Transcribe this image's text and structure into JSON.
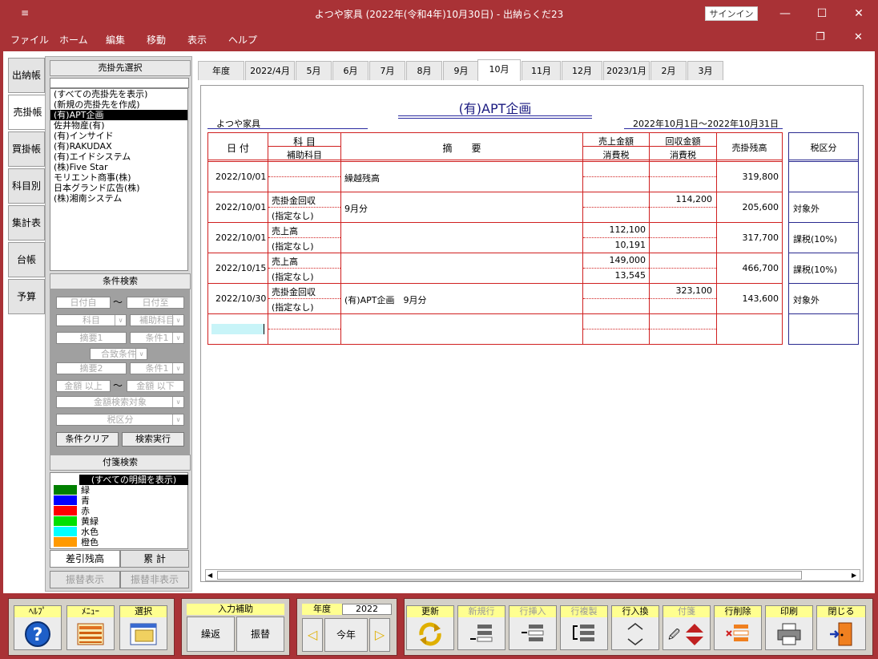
{
  "window": {
    "qa_icon": "≡",
    "title": "よつや家具 (2022年(令和4年)10月30日)  -  出納らくだ23",
    "signin": "サインイン",
    "min": "—",
    "max": "☐",
    "close": "✕",
    "restore": "❐"
  },
  "menu": [
    "ファイル",
    "ホーム",
    "編集",
    "移動",
    "表示",
    "ヘルプ"
  ],
  "side_tabs": [
    "出納帳",
    "売掛帳",
    "買掛帳",
    "科目別",
    "集計表",
    "台帳",
    "予算"
  ],
  "customer_panel": {
    "header": "売掛先選択",
    "items": [
      "(すべての売掛先を表示)",
      "(新規の売掛先を作成)",
      "(有)APT企画",
      "佐井物産(有)",
      "(有)インサイド",
      "(有)RAKUDAX",
      "(有)エイドシステム",
      "(株)Five Star",
      "モリエント商事(株)",
      "日本グランド広告(株)",
      "(株)湘南システム"
    ],
    "selected_index": 2
  },
  "search_panel": {
    "header": "条件検索",
    "date_from": "日付自",
    "tilde": "〜",
    "date_to": "日付至",
    "subject": "科目",
    "sub_subject": "補助科目",
    "memo1": "摘要1",
    "cond1": "条件1",
    "match": "合致条件",
    "memo2": "摘要2",
    "cond2": "条件1",
    "amount_from": "金額 以上",
    "amount_to": "金額 以下",
    "amount_target": "金額検索対象",
    "tax": "税区分",
    "clear": "条件クリア",
    "run": "検索実行"
  },
  "tag_panel": {
    "header": "付箋検索",
    "all": "(すべての明細を表示)",
    "tags": [
      {
        "label": "緑",
        "color": "#008000"
      },
      {
        "label": "青",
        "color": "#0000ff"
      },
      {
        "label": "赤",
        "color": "#ff0000"
      },
      {
        "label": "黄緑",
        "color": "#00e000"
      },
      {
        "label": "水色",
        "color": "#00ffff"
      },
      {
        "label": "橙色",
        "color": "#ff9900"
      }
    ]
  },
  "bottom_tabs": {
    "diff": "差引残高",
    "cumulative": "累 計",
    "transfer_show": "振替表示",
    "transfer_hide": "振替非表示"
  },
  "month_tabs": [
    "年度",
    "2022/4月",
    "5月",
    "6月",
    "7月",
    "8月",
    "9月",
    "10月",
    "11月",
    "12月",
    "2023/1月",
    "2月",
    "3月"
  ],
  "active_month_index": 7,
  "ledger": {
    "customer": "(有)APT企画",
    "company": "よつや家具",
    "period": "2022年10月1日〜2022年10月31日",
    "headers": {
      "date": "日 付",
      "subject": "科 目",
      "sub_subject": "補助科目",
      "memo": "摘　　要",
      "sales": "売上金額",
      "sales_tax": "消費税",
      "collect": "回収金額",
      "collect_tax": "消費税",
      "balance": "売掛残高",
      "tax_class": "税区分"
    },
    "rows": [
      {
        "date": "2022/10/01",
        "subject": "",
        "sub": "",
        "memo": "繰越残高",
        "sales": "",
        "sales_tax": "",
        "collect": "",
        "collect_tax": "",
        "balance": "319,800",
        "tax_class": ""
      },
      {
        "date": "2022/10/01",
        "subject": "売掛金回収",
        "sub": "(指定なし)",
        "memo": "9月分",
        "sales": "",
        "sales_tax": "",
        "collect": "114,200",
        "collect_tax": "",
        "balance": "205,600",
        "tax_class": "対象外"
      },
      {
        "date": "2022/10/01",
        "subject": "売上高",
        "sub": "(指定なし)",
        "memo": "",
        "sales": "112,100",
        "sales_tax": "10,191",
        "collect": "",
        "collect_tax": "",
        "balance": "317,700",
        "tax_class": "課税(10%)"
      },
      {
        "date": "2022/10/15",
        "subject": "売上高",
        "sub": "(指定なし)",
        "memo": "",
        "sales": "149,000",
        "sales_tax": "13,545",
        "collect": "",
        "collect_tax": "",
        "balance": "466,700",
        "tax_class": "課税(10%)"
      },
      {
        "date": "2022/10/30",
        "subject": "売掛金回収",
        "sub": "(指定なし)",
        "memo": "(有)APT企画　9月分",
        "sales": "",
        "sales_tax": "",
        "collect": "323,100",
        "collect_tax": "",
        "balance": "143,600",
        "tax_class": "対象外"
      },
      {
        "date": "",
        "subject": "",
        "sub": "",
        "memo": "",
        "sales": "",
        "sales_tax": "",
        "collect": "",
        "collect_tax": "",
        "balance": "",
        "tax_class": ""
      }
    ]
  },
  "toolbar": {
    "help": "ﾍﾙﾌﾟ",
    "menu": "ﾒﾆｭｰ",
    "select": "選択",
    "input_assist": "入力補助",
    "repeat": "繰返",
    "transfer": "振替",
    "year_label": "年度",
    "year": "2022",
    "this_year": "今年",
    "update": "更新",
    "new_row": "新規行",
    "insert_row": "行挿入",
    "copy_row": "行複製",
    "swap_row": "行入換",
    "tag": "付箋",
    "delete_row": "行削除",
    "print": "印刷",
    "close": "閉じる"
  }
}
